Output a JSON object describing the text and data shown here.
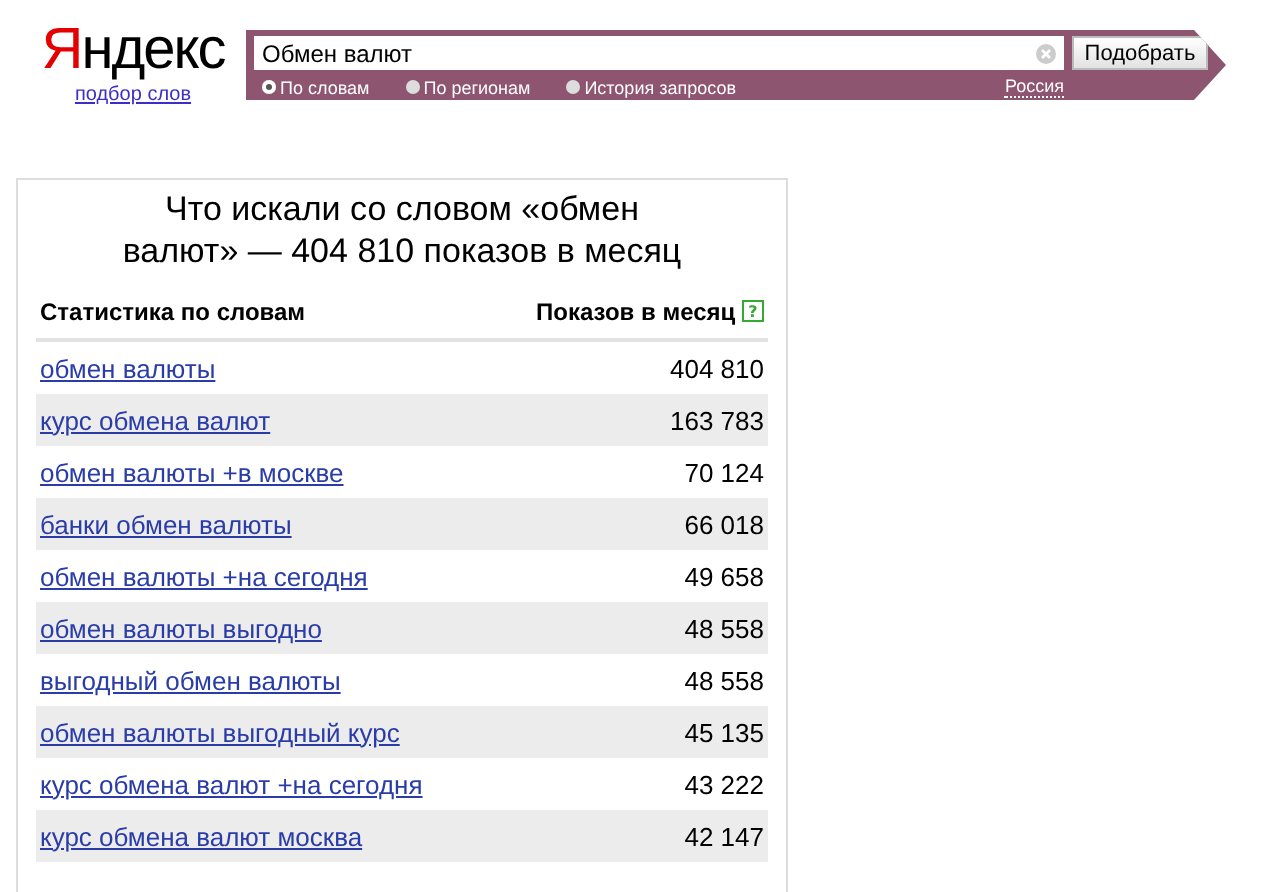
{
  "logo": {
    "text": "Яндекс",
    "subtitle": "подбор слов"
  },
  "search": {
    "value": "Обмен валют",
    "button": "Подобрать",
    "region": "Россия",
    "modes": [
      {
        "label": "По словам",
        "selected": true
      },
      {
        "label": "По регионам",
        "selected": false
      },
      {
        "label": "История запросов",
        "selected": false
      }
    ]
  },
  "results": {
    "title": "Что искали со словом «обмен валют» — 404 810 показов в месяц",
    "columns": [
      "Статистика по словам",
      "Показов в месяц"
    ],
    "help": "?",
    "rows": [
      {
        "phrase": "обмен валюты",
        "count": "404 810"
      },
      {
        "phrase": "курс обмена валют",
        "count": "163 783"
      },
      {
        "phrase": "обмен валюты +в москве",
        "count": "70 124"
      },
      {
        "phrase": "банки обмен валюты",
        "count": "66 018"
      },
      {
        "phrase": "обмен валюты +на сегодня",
        "count": "49 658"
      },
      {
        "phrase": "обмен валюты выгодно",
        "count": "48 558"
      },
      {
        "phrase": "выгодный обмен валюты",
        "count": "48 558"
      },
      {
        "phrase": "обмен валюты выгодный курс",
        "count": "45 135"
      },
      {
        "phrase": "курс обмена валют +на сегодня",
        "count": "43 222"
      },
      {
        "phrase": "курс обмена валют москва",
        "count": "42 147"
      }
    ]
  }
}
